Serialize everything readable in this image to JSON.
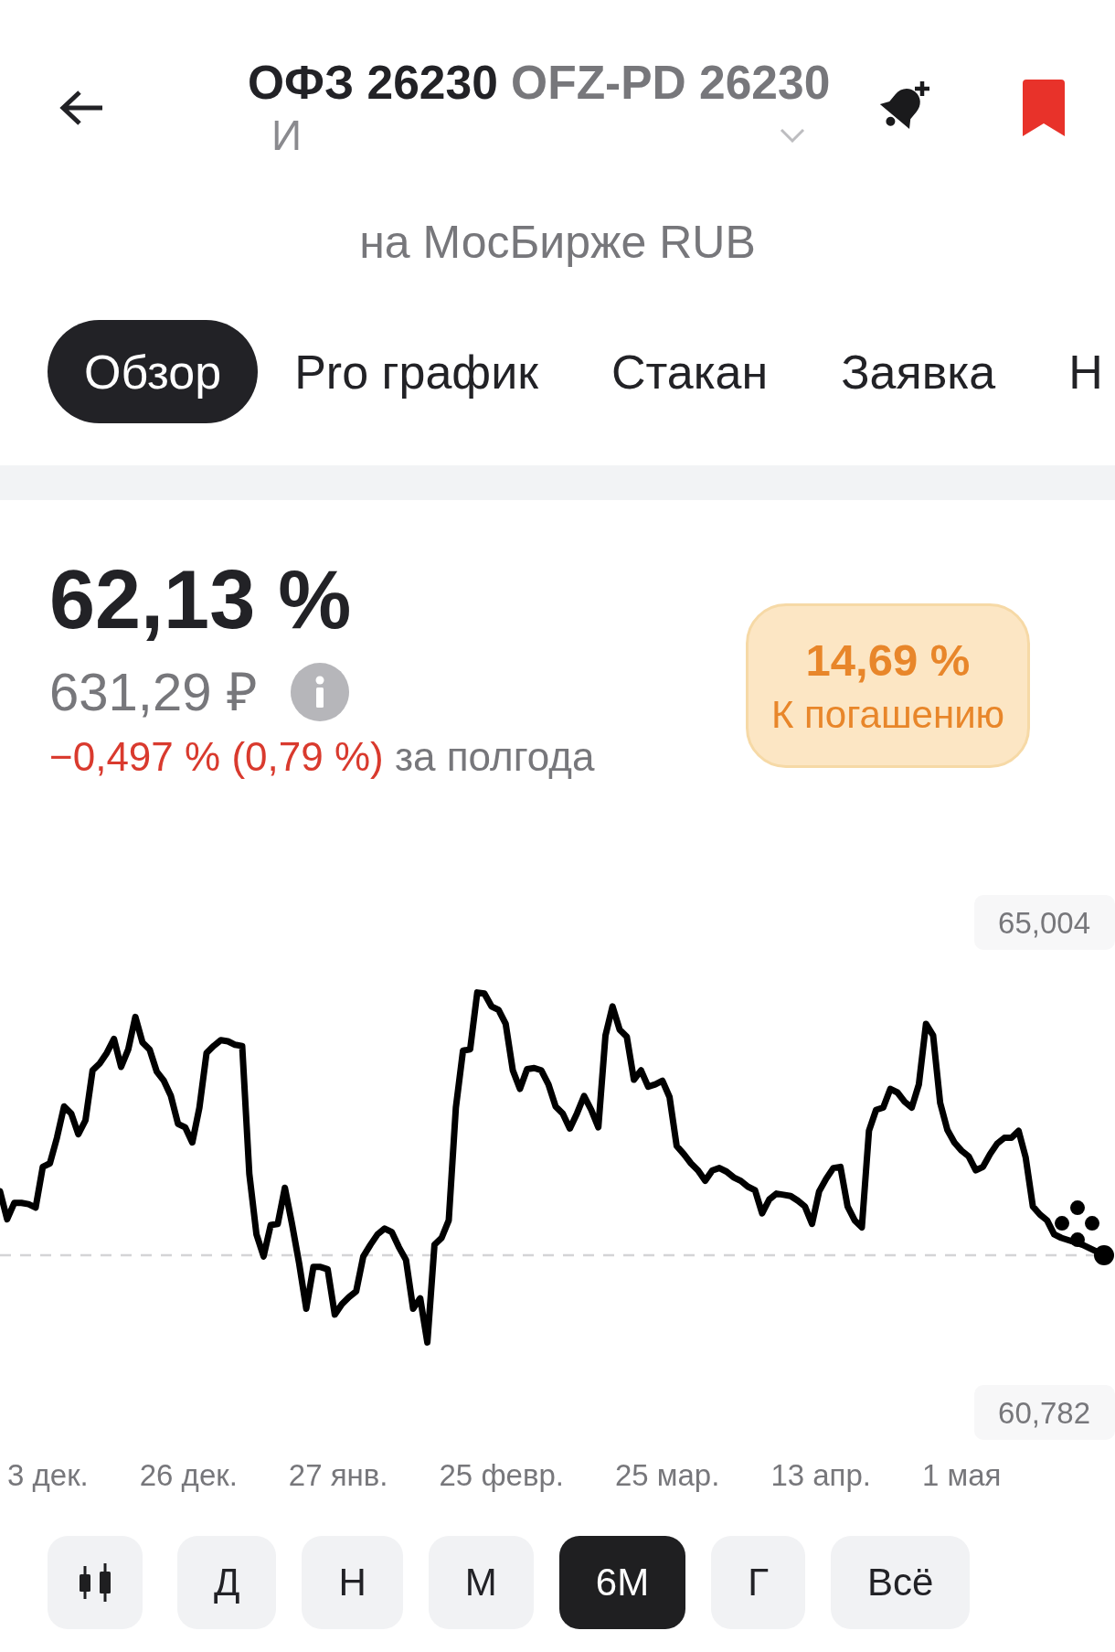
{
  "header": {
    "ticker": "ОФЗ 26230",
    "name": "OFZ-PD 26230",
    "account": "И",
    "exchange": "на МосБирже RUB",
    "bookmarked": true
  },
  "tabs": [
    {
      "label": "Обзор",
      "selected": true
    },
    {
      "label": "Pro график",
      "selected": false
    },
    {
      "label": "Стакан",
      "selected": false
    },
    {
      "label": "Заявка",
      "selected": false
    },
    {
      "label": "Н",
      "selected": false
    }
  ],
  "quote": {
    "price_percent": "62,13 %",
    "price_rub": "631,29 ₽",
    "change": "−0,497 % (0,79 %)",
    "period": "за полгода",
    "negative": true
  },
  "yield_badge": {
    "value": "14,69 %",
    "label": "К погашению"
  },
  "chart": {
    "scale_max": "65,004",
    "scale_min": "60,782",
    "date_labels": [
      "3 дек.",
      "26 дек.",
      "27 янв.",
      "25 февр.",
      "25 мар.",
      "13 апр.",
      "1 мая"
    ]
  },
  "range_buttons": [
    {
      "kind": "icon",
      "selected": false
    },
    {
      "kind": "text",
      "label": "Д",
      "selected": false
    },
    {
      "kind": "text",
      "label": "Н",
      "selected": false
    },
    {
      "kind": "text",
      "label": "М",
      "selected": false
    },
    {
      "kind": "text",
      "label": "6М",
      "selected": true
    },
    {
      "kind": "text",
      "label": "Г",
      "selected": false
    },
    {
      "kind": "text",
      "label": "Всё",
      "selected": false
    }
  ]
}
